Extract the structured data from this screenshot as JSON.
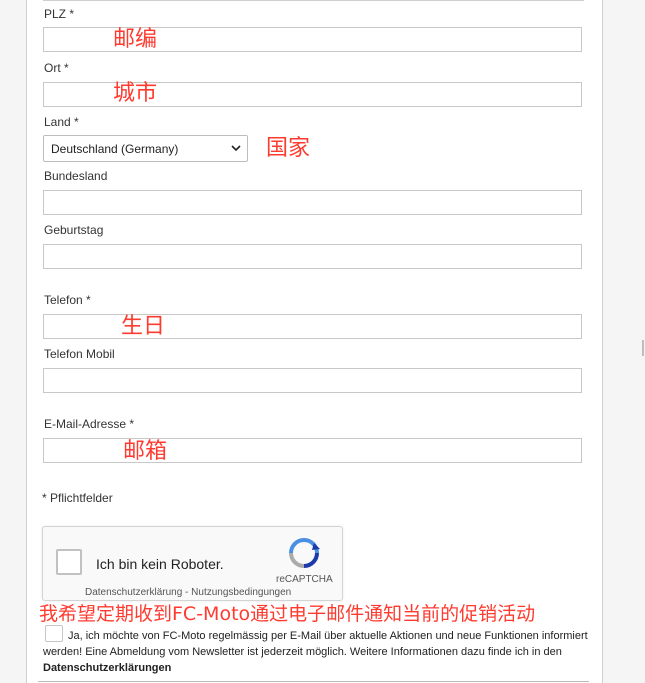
{
  "fields": {
    "plz": {
      "label": "PLZ *",
      "value": ""
    },
    "ort": {
      "label": "Ort *",
      "value": ""
    },
    "land": {
      "label": "Land *",
      "selected": "Deutschland (Germany)"
    },
    "bundesland": {
      "label": "Bundesland",
      "value": ""
    },
    "geburtstag": {
      "label": "Geburtstag",
      "value": ""
    },
    "telefon": {
      "label": "Telefon *",
      "value": ""
    },
    "telefon_mobil": {
      "label": "Telefon Mobil",
      "value": ""
    },
    "email": {
      "label": "E-Mail-Adresse *",
      "value": ""
    }
  },
  "annotations": {
    "plz": "邮编",
    "ort": "城市",
    "land": "国家",
    "telefon": "生日",
    "email": "邮箱",
    "newsletter": "我希望定期收到FC-Moto通过电子邮件通知当前的促销活动"
  },
  "required_note": "* Pflichtfelder",
  "recaptcha": {
    "label": "Ich bin kein Roboter.",
    "brand": "reCAPTCHA",
    "links": "Datenschutzerklärung - Nutzungsbedingungen"
  },
  "newsletter": {
    "text_before": "Ja, ich möchte von FC-Moto regelmässig per E-Mail über aktuelle Aktionen und neue Funktionen informiert werden! Eine Abmeldung vom Newsletter ist jederzeit möglich. Weitere Informationen dazu finde ich in den ",
    "link": "Datenschutzerklärungen"
  },
  "colors": {
    "annotation": "#ff3b30",
    "border": "#c8c8c8"
  },
  "icons": {
    "select": "chevron-down-icon",
    "recaptcha": "recaptcha-logo-icon"
  }
}
